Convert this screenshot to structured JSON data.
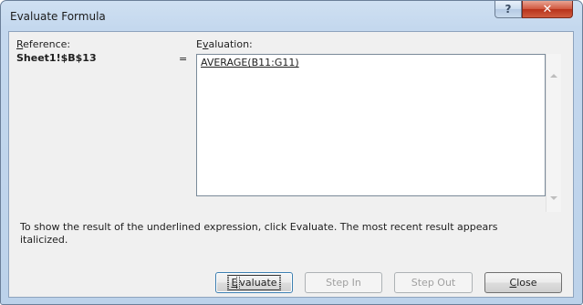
{
  "window": {
    "title": "Evaluate Formula",
    "help_glyph": "?",
    "close_glyph": "✕"
  },
  "reference": {
    "label_prefix": "R",
    "label_rest": "eference:",
    "value": "Sheet1!$B$13"
  },
  "equals_sign": "=",
  "evaluation": {
    "label_prefix": "E",
    "label_mnemonic": "v",
    "label_rest": "aluation:",
    "expression": "AVERAGE(B11:G11)"
  },
  "hint": "To show the result of the underlined expression, click Evaluate.  The most recent result appears italicized.",
  "buttons": {
    "evaluate": {
      "mnemonic": "E",
      "rest": "valuate"
    },
    "step_in": {
      "label": "Step In"
    },
    "step_out": {
      "label": "Step Out"
    },
    "close": {
      "mnemonic": "C",
      "rest": "lose"
    }
  },
  "colors": {
    "titlebar": "#c4d8ee",
    "close_button": "#c7432a",
    "client_bg": "#f0f0f0",
    "default_button_border": "#3c7fb1"
  }
}
